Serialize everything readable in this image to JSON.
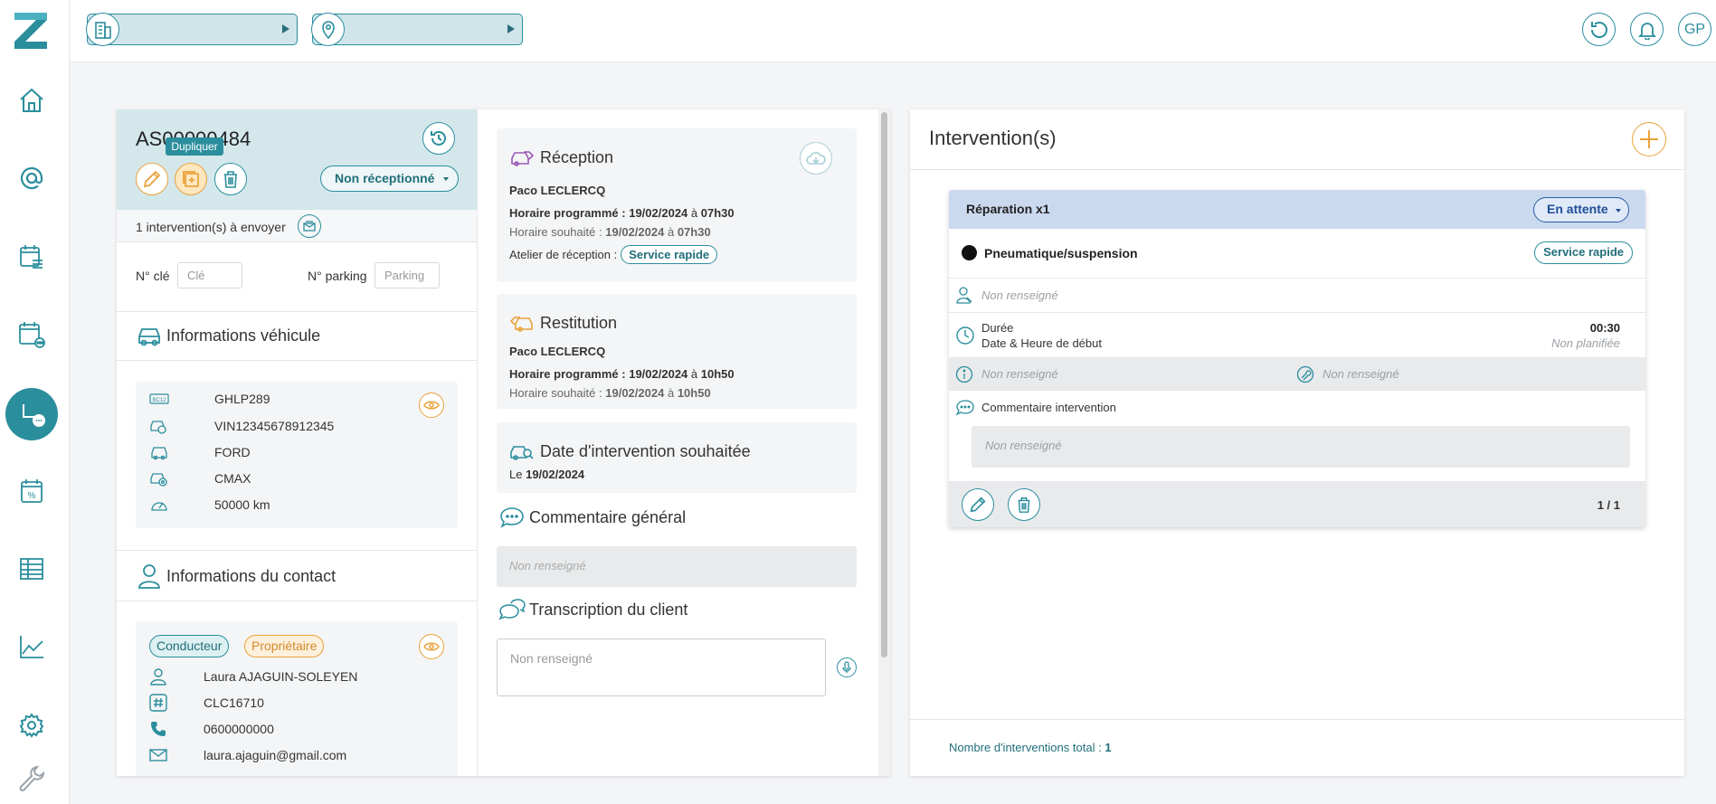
{
  "sidebar": {
    "logo": "Z",
    "items": [
      {
        "icon": "home-icon"
      },
      {
        "icon": "at-icon"
      },
      {
        "icon": "calendar-list-icon"
      },
      {
        "icon": "calendar-more-icon"
      },
      {
        "icon": "reception-icon",
        "active": true
      },
      {
        "icon": "calendar-percent-icon"
      },
      {
        "icon": "table-icon"
      },
      {
        "icon": "chart-icon"
      },
      {
        "icon": "gear-icon"
      },
      {
        "icon": "wrench-icon"
      }
    ]
  },
  "topbar": {
    "site_select": {
      "icon": "building-icon",
      "value": ""
    },
    "location_select": {
      "icon": "location-pin-icon",
      "value": ""
    },
    "user_initials": "GP"
  },
  "order": {
    "reference": "AS00000484",
    "tooltip": "Dupliquer",
    "status": "Non réceptionné",
    "to_send": "1 intervention(s) à envoyer",
    "key_label": "N° clé",
    "key_placeholder": "Clé",
    "parking_label": "N° parking",
    "parking_placeholder": "Parking"
  },
  "vehicle": {
    "title": "Informations véhicule",
    "plate": "GHLP289",
    "vin": "VIN12345678912345",
    "brand": "FORD",
    "model": "CMAX",
    "mileage": "50000 km"
  },
  "contact": {
    "title": "Informations du contact",
    "tag_driver": "Conducteur",
    "tag_owner": "Propriétaire",
    "name": "Laura AJAGUIN-SOLEYEN",
    "client_code": "CLC16710",
    "phone": "0600000000",
    "email": "laura.ajaguin@gmail.com"
  },
  "reception": {
    "title": "Réception",
    "person": "Paco LECLERCQ",
    "scheduled_label": "Horaire programmé :",
    "scheduled_date": "19/02/2024",
    "scheduled_at": "à",
    "scheduled_time": "07h30",
    "wished_label": "Horaire souhaité :",
    "wished_date": "19/02/2024",
    "wished_at": "à",
    "wished_time": "07h30",
    "workshop_label": "Atelier de réception :",
    "workshop": "Service rapide"
  },
  "restitution": {
    "title": "Restitution",
    "person": "Paco LECLERCQ",
    "scheduled_label": "Horaire programmé :",
    "scheduled_date": "19/02/2024",
    "scheduled_at": "à",
    "scheduled_time": "10h50",
    "wished_label": "Horaire souhaité :",
    "wished_date": "19/02/2024",
    "wished_at": "à",
    "wished_time": "10h50"
  },
  "wished_date": {
    "title": "Date d'intervention souhaitée",
    "prefix": "Le",
    "date": "19/02/2024"
  },
  "general_comment": {
    "title": "Commentaire général",
    "value": "Non renseigné"
  },
  "transcription": {
    "title": "Transcription du client",
    "placeholder": "Non renseigné"
  },
  "interventions": {
    "title": "Intervention(s)",
    "card": {
      "title": "Réparation x1",
      "status": "En attente",
      "category": "Pneumatique/suspension",
      "workshop": "Service rapide",
      "technician": "Non renseigné",
      "duration_label": "Durée",
      "duration": "00:30",
      "start_label": "Date & Heure de début",
      "start": "Non planifiée",
      "info": "Non renseigné",
      "tool": "Non renseigné",
      "comment_label": "Commentaire intervention",
      "comment": "Non renseigné",
      "pager": "1 / 1"
    },
    "total_label": "Nombre d'interventions total :",
    "total": "1"
  },
  "colors": {
    "teal": "#2b8e9d",
    "orange": "#e9a23b",
    "blue": "#2a5ea8"
  }
}
